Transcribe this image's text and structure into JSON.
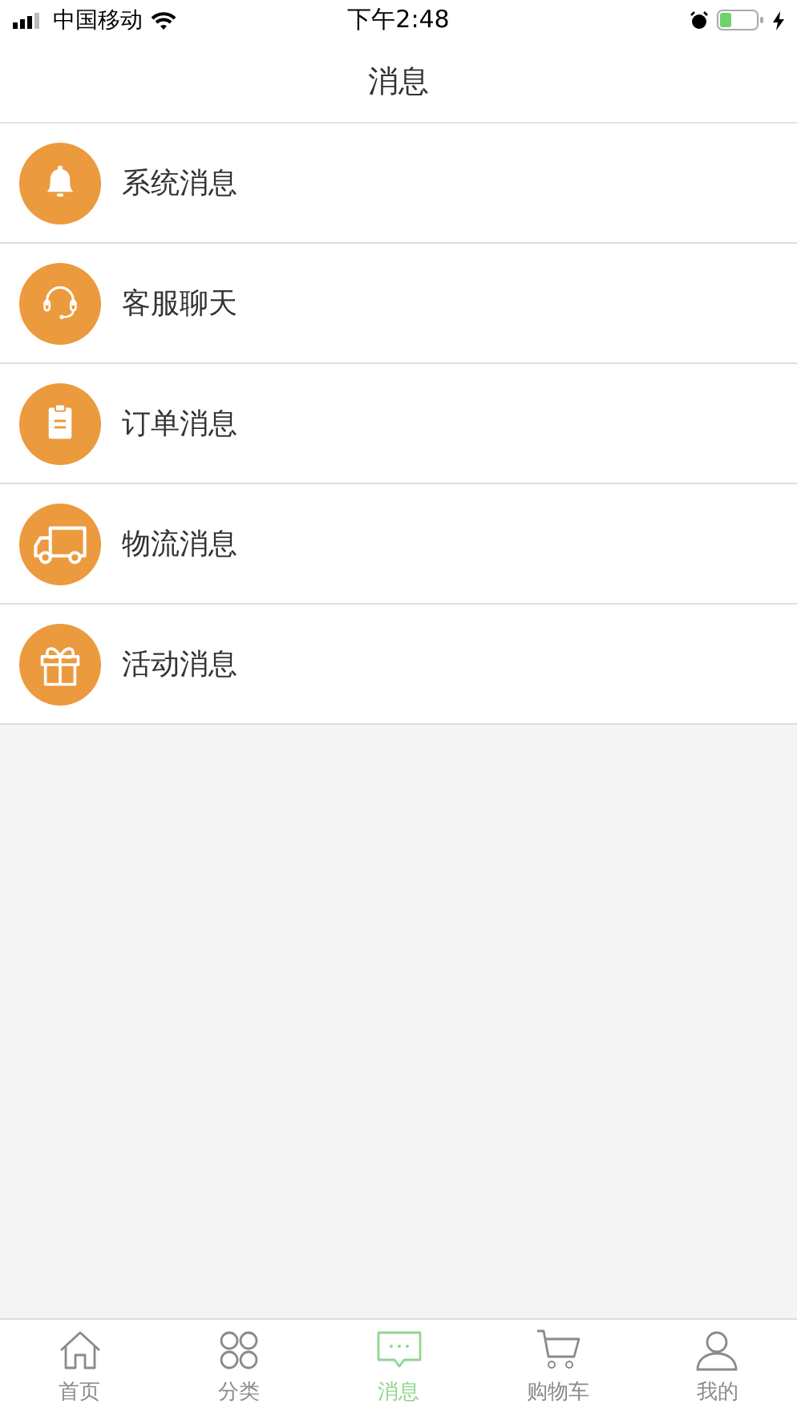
{
  "status_bar": {
    "carrier": "中国移动",
    "time": "下午2:48"
  },
  "header": {
    "title": "消息"
  },
  "items": [
    {
      "kind": "bell",
      "label": "系统消息"
    },
    {
      "kind": "headset",
      "label": "客服聊天"
    },
    {
      "kind": "clipboard",
      "label": "订单消息"
    },
    {
      "kind": "truck",
      "label": "物流消息"
    },
    {
      "kind": "gift",
      "label": "活动消息"
    }
  ],
  "tab_bar": [
    {
      "kind": "home",
      "label": "首页",
      "selected": false
    },
    {
      "kind": "category",
      "label": "分类",
      "selected": false
    },
    {
      "kind": "message",
      "label": "消息",
      "selected": true
    },
    {
      "kind": "cart",
      "label": "购物车",
      "selected": false
    },
    {
      "kind": "profile",
      "label": "我的",
      "selected": false
    }
  ]
}
